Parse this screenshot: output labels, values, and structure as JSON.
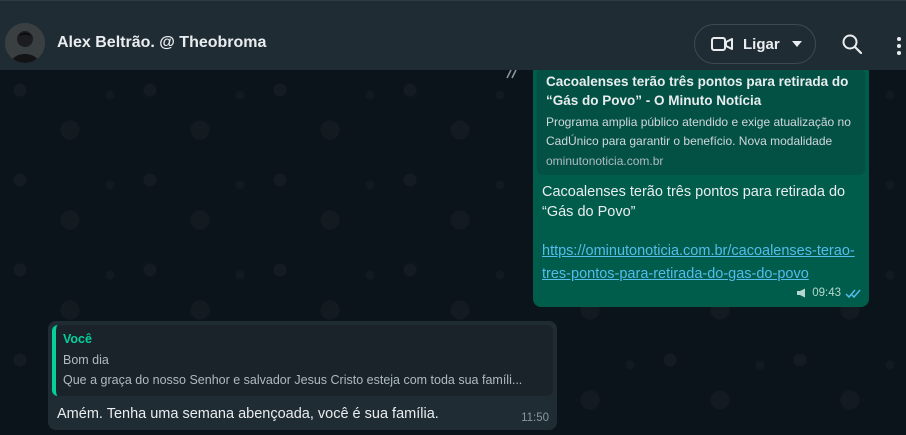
{
  "header": {
    "contact_name": "Alex Beltrão. @ Theobroma",
    "call_label": "Ligar",
    "icons": {
      "video": "video-camera-icon",
      "caret": "chevron-down-icon",
      "search": "search-icon",
      "menu": "kebab-menu-icon"
    }
  },
  "outgoing": {
    "preview": {
      "title": "Cacoalenses terão três pontos para retirada do “Gás do Povo” - O Minuto Notícia",
      "description": "Programa amplia público atendido e exige atualização no CadÚnico para garantir o benefício. Nova modalidade",
      "domain": "ominutonoticia.com.br"
    },
    "text": "Cacoalenses terão três pontos para retirada do “Gás do Povo”",
    "link": "https://ominutonoticia.com.br/cacoalenses-terao-tres-pontos-para-retirada-do-gas-do-povo",
    "time": "09:43",
    "status": "read"
  },
  "incoming": {
    "quote": {
      "author": "Você",
      "line1": "Bom dia",
      "line2": "Que a graça do nosso Senhor e salvador Jesus Cristo esteja com toda sua famíli..."
    },
    "text": "Amém. Tenha uma semana abençoada, você é sua família.",
    "time": "11:50"
  },
  "colors": {
    "header_bg": "#202c33",
    "chat_bg": "#0b141a",
    "outgoing_bubble": "#005c4b",
    "incoming_bubble": "#202c33",
    "link": "#53bdeb",
    "accent": "#06cf9c"
  }
}
